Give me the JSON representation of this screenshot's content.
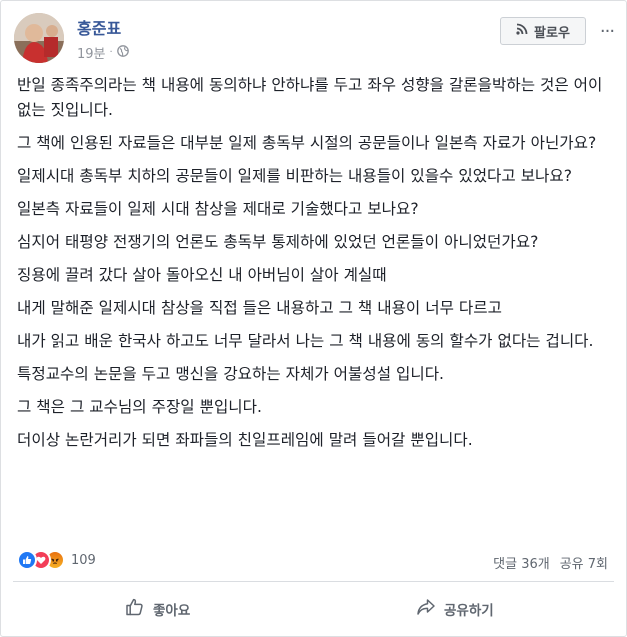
{
  "post": {
    "author": "홍준표",
    "time": "19분",
    "meta_separator": "·",
    "privacy_icon": "globe-icon",
    "follow_label": "팔로우",
    "more_label": "···",
    "paragraphs": [
      "반일 종족주의라는 책 내용에 동의하냐 안하냐를 두고 좌우 성향을 갈론을박하는 것은 어이 없는 짓입니다.",
      "그 책에 인용된 자료들은 대부분 일제 총독부 시절의 공문들이나 일본측 자료가 아닌가요?",
      "일제시대 총독부 치하의 공문들이 일제를 비판하는 내용들이 있을수 있었다고 보나요?",
      "일본측 자료들이 일제 시대 참상을 제대로 기술했다고 보나요?",
      "심지어 태평양 전쟁기의 언론도 총독부 통제하에 있었던 언론들이 아니었던가요?",
      "징용에 끌려 갔다 살아 돌아오신 내 아버님이 살아 계실때",
      "내게 말해준 일제시대 참상을 직접 들은 내용하고 그 책 내용이 너무 다르고",
      "내가 읽고 배운 한국사 하고도 너무 달라서 나는 그 책 내용에 동의 할수가 없다는 겁니다.",
      "특정교수의 논문을 두고 맹신을 강요하는 자체가 어불성설 입니다.",
      "그 책은 그 교수님의 주장일 뿐입니다.",
      "더이상 논란거리가 되면 좌파들의 친일프레임에 말려 들어갈 뿐입니다."
    ]
  },
  "engagement": {
    "reaction_count": "109",
    "reaction_icons": [
      "like-icon",
      "love-icon",
      "angry-icon"
    ],
    "comments": "댓글 36개",
    "shares": "공유 7회"
  },
  "actions": {
    "like_label": "좋아요",
    "share_label": "공유하기"
  },
  "colors": {
    "author": "#385898",
    "like": "#2078f4",
    "love": "#f33e58",
    "angry": "#e9710f"
  }
}
